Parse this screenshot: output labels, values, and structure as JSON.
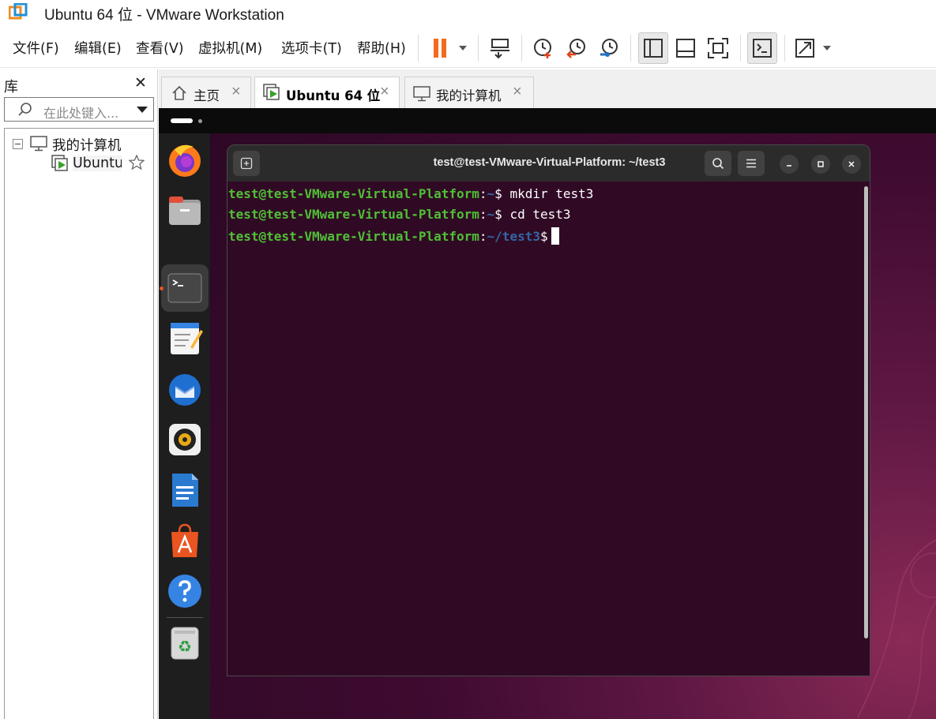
{
  "window": {
    "title": "Ubuntu 64 位 - VMware Workstation"
  },
  "menu": {
    "items": [
      "文件(F)",
      "编辑(E)",
      "查看(V)",
      "虚拟机(M)",
      "选项卡(T)",
      "帮助(H)"
    ]
  },
  "toolbar": {
    "buttons": [
      "pause",
      "send-ctrl-alt-del",
      "snapshot",
      "revert-snapshot",
      "snapshot-manager",
      "library-view",
      "thumbnail-bar",
      "fullscreen",
      "console-view",
      "stretch"
    ]
  },
  "library": {
    "title": "库",
    "search_placeholder": "在此处键入...",
    "tree": {
      "root": "我的计算机",
      "child": "Ubuntu"
    }
  },
  "tabs": [
    {
      "label": "主页",
      "active": false
    },
    {
      "label": "Ubuntu 64 位",
      "active": true
    },
    {
      "label": "我的计算机",
      "active": false
    }
  ],
  "terminal": {
    "title": "test@test-VMware-Virtual-Platform: ~/test3",
    "lines": [
      {
        "user": "test@test-VMware-Virtual-Platform",
        "sep": ":",
        "path": "~",
        "sym": "$",
        "cmd": " mkdir test3"
      },
      {
        "user": "test@test-VMware-Virtual-Platform",
        "sep": ":",
        "path": "~",
        "sym": "$",
        "cmd": " cd test3"
      },
      {
        "user": "test@test-VMware-Virtual-Platform",
        "sep": ":",
        "path": "~/test3",
        "sym": "$",
        "cmd": ""
      }
    ]
  },
  "dock": {
    "apps": [
      "firefox",
      "files",
      "terminal",
      "text-editor",
      "thunderbird",
      "rhythmbox",
      "libreoffice-writer",
      "app-center",
      "help",
      "trash"
    ]
  },
  "colors": {
    "terminal_bg": "#300a24",
    "prompt_user": "#4fc035",
    "prompt_path": "#3465a4",
    "pause_orange": "#f26b1d"
  }
}
